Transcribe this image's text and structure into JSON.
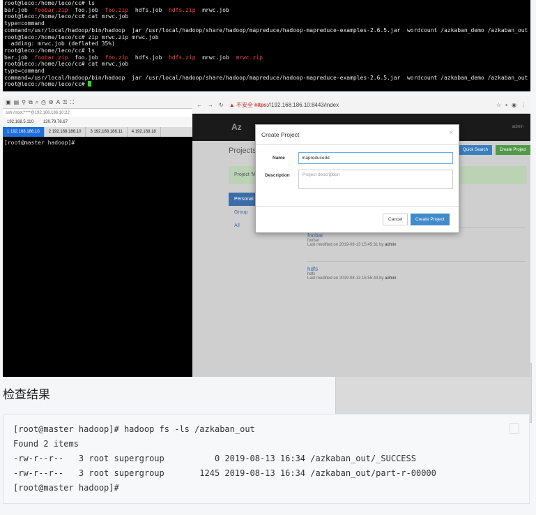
{
  "terminal_top": {
    "lines": [
      [
        {
          "t": "root@leco:/home/leco/cc# ls"
        }
      ],
      [
        {
          "t": "bar.job  "
        },
        {
          "t": "foobar.zip",
          "red": true
        },
        {
          "t": "  foo.job  "
        },
        {
          "t": "foo.zip",
          "red": true
        },
        {
          "t": "  hdfs.job  "
        },
        {
          "t": "hdfs.zip",
          "red": true
        },
        {
          "t": "  mrwc.job"
        }
      ],
      [
        {
          "t": "root@leco:/home/leco/cc# cat mrwc.job"
        }
      ],
      [
        {
          "t": "type=command"
        }
      ],
      [
        {
          "t": "command=/usr/local/hadoop/bin/hadoop  jar /usr/local/hadoop/share/hadoop/mapreduce/hadoop-mapreduce-examples-2.6.5.jar  wordcount /azkaban_demo /azkaban_out"
        }
      ],
      [
        {
          "t": "root@leco:/home/leco/cc# zip mrwc.zip mrwc.job"
        }
      ],
      [
        {
          "t": "  adding: mrwc.job (deflated 35%)"
        }
      ],
      [
        {
          "t": "root@leco:/home/leco/cc# ls"
        }
      ],
      [
        {
          "t": "bar.job  "
        },
        {
          "t": "foobar.zip",
          "red": true
        },
        {
          "t": "  foo.job  "
        },
        {
          "t": "foo.zip",
          "red": true
        },
        {
          "t": "  hdfs.job  "
        },
        {
          "t": "hdfs.zip",
          "red": true
        },
        {
          "t": "  mrwc.job  "
        },
        {
          "t": "mrwc.zip",
          "red": true
        }
      ],
      [
        {
          "t": "root@leco:/home/leco/cc# cat mrwc.job"
        }
      ],
      [
        {
          "t": "type=command"
        }
      ],
      [
        {
          "t": "command=/usr/local/hadoop/bin/hadoop  jar /usr/local/hadoop/share/hadoop/mapreduce/hadoop-mapreduce-examples-2.6.5.jar  wordcount /azkaban_demo /azkaban_out"
        }
      ],
      [
        {
          "t": "root@leco:/home/leco/cc# "
        }
      ]
    ]
  },
  "ssh_client": {
    "address": "ssh://root:****@192.168.186.10:22",
    "hosts": [
      "192.168.5.110",
      "120.79.78.67"
    ],
    "tabs": [
      "1 192.168.186.10",
      "2 192.168.186.10",
      "3 192.168.186.11",
      "4 192.168.18"
    ],
    "prompt": "[root@master hadoop]# "
  },
  "browser": {
    "insecure_label": "不安全",
    "url_scheme": "https",
    "url_rest": "://192.168.186.10:8443/index",
    "brand": "Az",
    "user": "admin",
    "page_title": "Projects",
    "quick_search": "Quick Search",
    "create_project_btn": "Create Project",
    "alert_text": "Project 'M",
    "side": [
      "Personal",
      "Group",
      "All"
    ],
    "projects": [
      {
        "name": "foobar",
        "desc": "foobar",
        "modified_label": "Last modified on",
        "date": "2019-08-13 15:45:31",
        "by_label": "by",
        "user": "admin"
      },
      {
        "name": "hdfs",
        "desc": "hdfs",
        "modified_label": "Last modified on",
        "date": "2019-08-13 15:55:44",
        "by_label": "by",
        "user": "admin"
      }
    ]
  },
  "modal": {
    "title": "Create Project",
    "close": "×",
    "name_label": "Name",
    "name_value": "mapreducedd",
    "description_label": "Description",
    "description_placeholder": "Project description",
    "cancel": "Cancel",
    "create": "Create Project"
  },
  "heading": "检查结果",
  "code_block": {
    "text": "[root@master hadoop]# hadoop fs -ls /azkaban_out\nFound 2 items\n-rw-r--r--   3 root supergroup          0 2019-08-13 16:34 /azkaban_out/_SUCCESS\n-rw-r--r--   3 root supergroup       1245 2019-08-13 16:34 /azkaban_out/part-r-00000\n[root@master hadoop]#"
  }
}
